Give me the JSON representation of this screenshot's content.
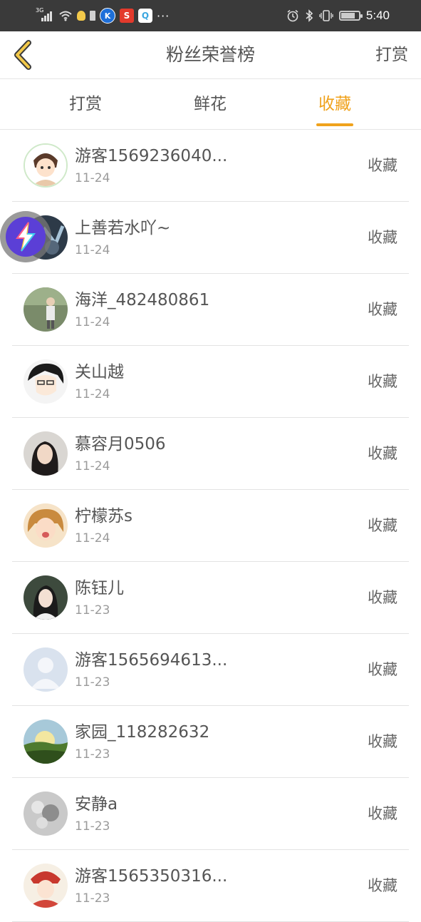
{
  "status_bar": {
    "network": "3G",
    "time": "5:40",
    "app_k": "K",
    "app_s": "S",
    "app_q": "Q",
    "more": "···",
    "battery_level": 0.8
  },
  "header": {
    "title": "粉丝荣誉榜",
    "action": "打赏"
  },
  "tabs": [
    {
      "label": "打赏"
    },
    {
      "label": "鲜花"
    },
    {
      "label": "收藏"
    }
  ],
  "active_tab": 2,
  "rows": [
    {
      "name": "游客1569236040...",
      "date": "11-24",
      "action": "收藏"
    },
    {
      "name": "上善若水吖~",
      "date": "11-24",
      "action": "收藏"
    },
    {
      "name": "海洋_482480861",
      "date": "11-24",
      "action": "收藏"
    },
    {
      "name": "关山越",
      "date": "11-24",
      "action": "收藏"
    },
    {
      "name": "慕容月0506",
      "date": "11-24",
      "action": "收藏"
    },
    {
      "name": "柠檬苏s",
      "date": "11-24",
      "action": "收藏"
    },
    {
      "name": "陈钰儿",
      "date": "11-23",
      "action": "收藏"
    },
    {
      "name": "游客1565694613...",
      "date": "11-23",
      "action": "收藏"
    },
    {
      "name": "家园_118282632",
      "date": "11-23",
      "action": "收藏"
    },
    {
      "name": "安静a",
      "date": "11-23",
      "action": "收藏"
    },
    {
      "name": "游客1565350316...",
      "date": "11-23",
      "action": "收藏"
    }
  ],
  "colors": {
    "accent": "#f0a21c",
    "status_bar": "#3a3a3a",
    "text": "#555555",
    "date": "#9b9b9b"
  }
}
